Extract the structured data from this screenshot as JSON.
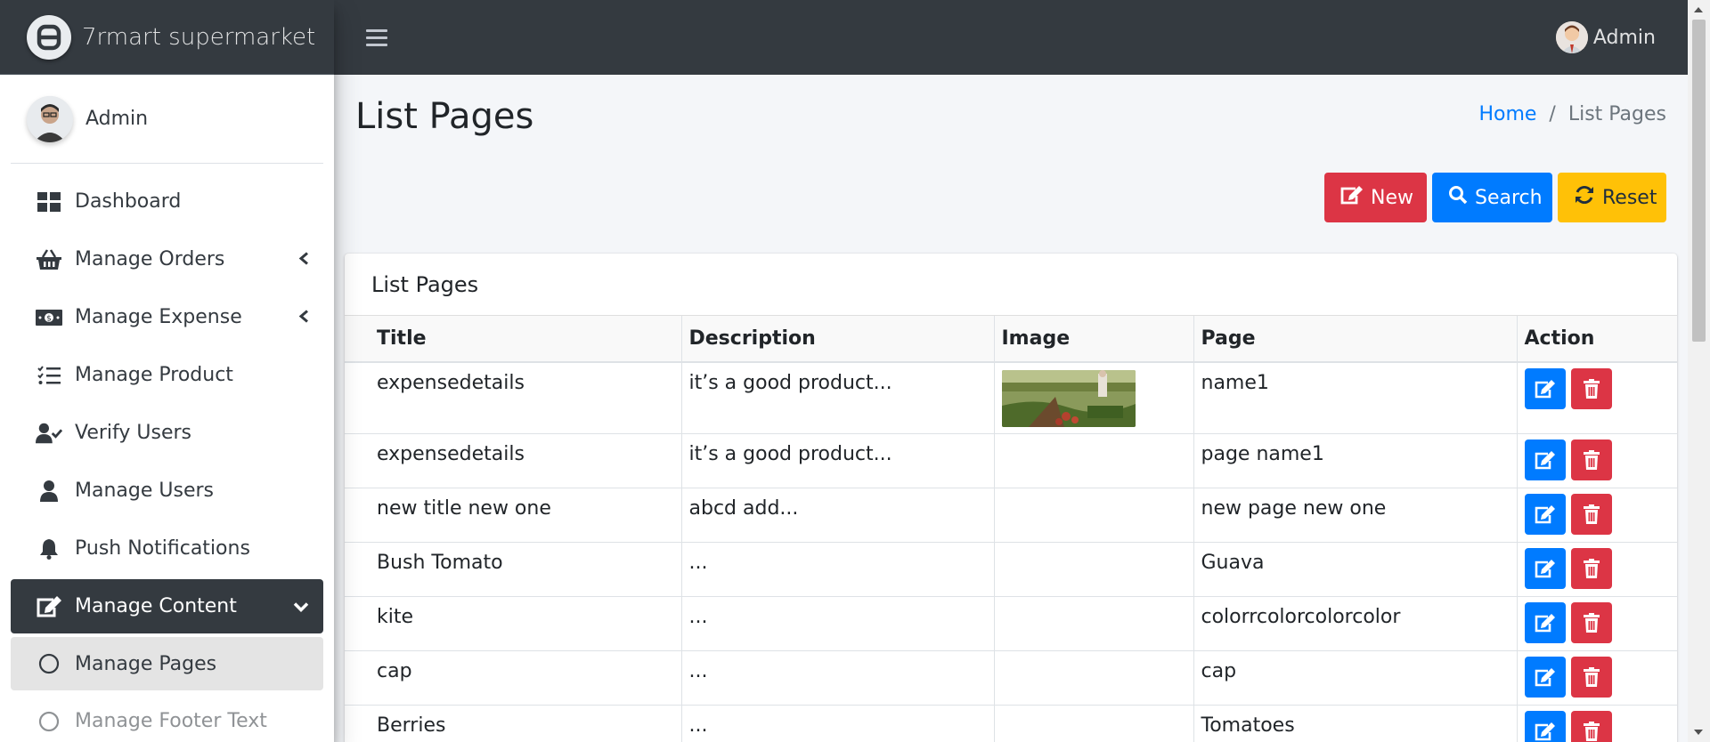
{
  "brand": {
    "name": "7rmart supermarket",
    "logo_icon": "brand-logo-icon"
  },
  "sidebar": {
    "user_name": "Admin",
    "items": [
      {
        "label": "Dashboard",
        "icon": "dashboard-icon",
        "has_chevron": false
      },
      {
        "label": "Manage Orders",
        "icon": "basket-icon",
        "has_chevron": true
      },
      {
        "label": "Manage Expense",
        "icon": "money-icon",
        "has_chevron": true
      },
      {
        "label": "Manage Product",
        "icon": "list-check-icon",
        "has_chevron": false
      },
      {
        "label": "Verify Users",
        "icon": "user-check-icon",
        "has_chevron": false
      },
      {
        "label": "Manage Users",
        "icon": "user-icon",
        "has_chevron": false
      },
      {
        "label": "Push Notifications",
        "icon": "bell-icon",
        "has_chevron": false
      },
      {
        "label": "Manage Content",
        "icon": "edit-icon",
        "has_chevron": true,
        "active": true
      },
      {
        "label": "Manage Pages",
        "icon": "circle-icon",
        "sub": true,
        "selected": true
      },
      {
        "label": "Manage Footer Text",
        "icon": "circle-icon",
        "sub": true
      }
    ]
  },
  "topbar": {
    "user_name": "Admin",
    "menu_icon": "hamburger-icon"
  },
  "page": {
    "title": "List Pages",
    "breadcrumb": {
      "home": "Home",
      "separator": "/",
      "current": "List Pages"
    }
  },
  "actions": {
    "new_label": "New",
    "search_label": "Search",
    "reset_label": "Reset"
  },
  "card": {
    "title": "List Pages",
    "columns": [
      "Title",
      "Description",
      "Image",
      "Page",
      "Action"
    ],
    "rows": [
      {
        "title": "expensedetails",
        "description": "it’s a good product...",
        "has_image": true,
        "page": "name1"
      },
      {
        "title": "expensedetails",
        "description": "it’s a good product...",
        "has_image": false,
        "page": "page name1"
      },
      {
        "title": "new title new one",
        "description": "abcd add...",
        "has_image": false,
        "page": "new page new one"
      },
      {
        "title": "Bush Tomato",
        "description": "...",
        "has_image": false,
        "page": "Guava"
      },
      {
        "title": "kite",
        "description": "...",
        "has_image": false,
        "page": "colorrcolorcolorcolor"
      },
      {
        "title": "cap",
        "description": "...",
        "has_image": false,
        "page": "cap"
      },
      {
        "title": "Berries",
        "description": "...",
        "has_image": false,
        "page": "Tomatoes"
      }
    ]
  },
  "colors": {
    "sidebar_dark": "#343a40",
    "primary": "#007bff",
    "danger": "#dc3545",
    "warning": "#ffc107"
  }
}
